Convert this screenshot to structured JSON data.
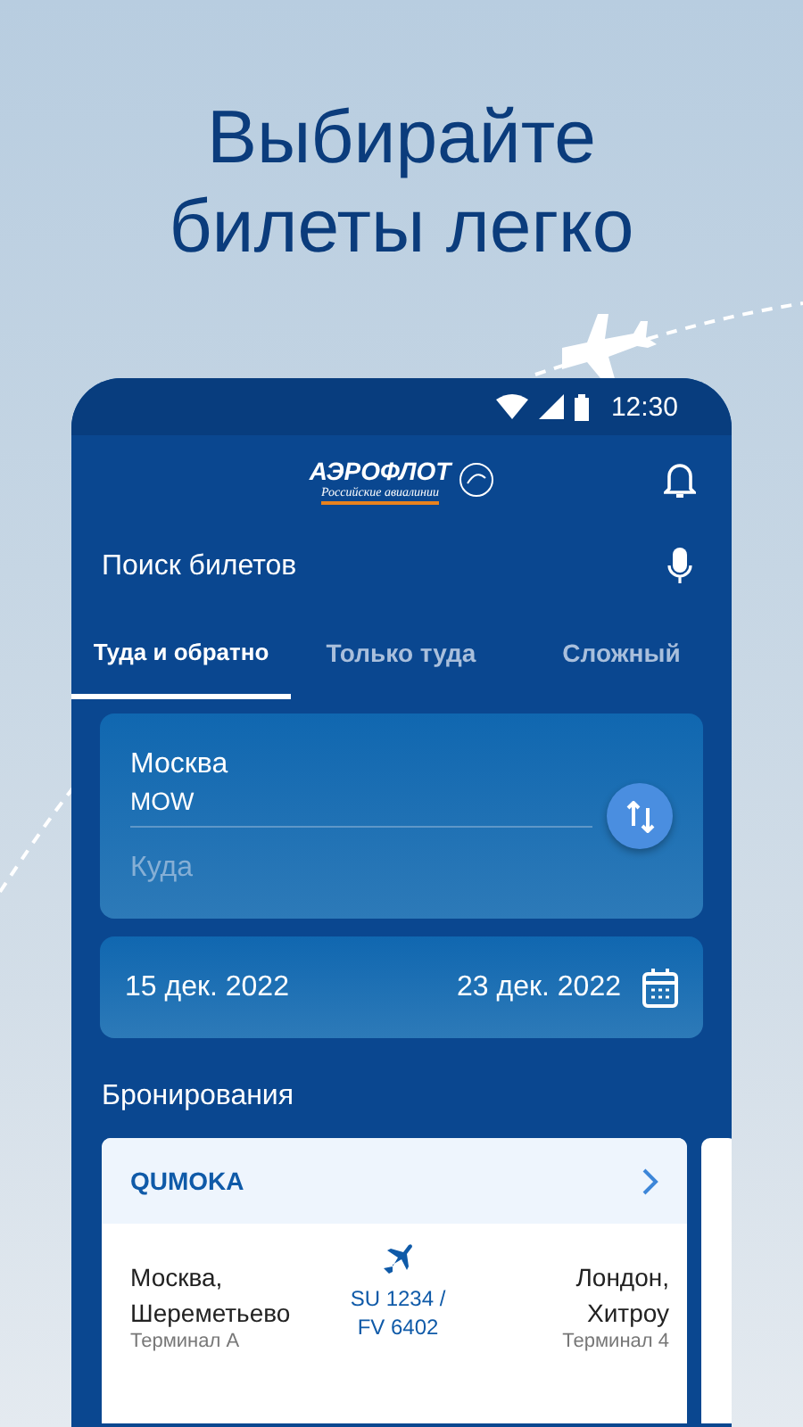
{
  "headline": "Выбирайте билеты легко",
  "status_bar": {
    "time": "12:30"
  },
  "logo": {
    "name": "АЭРОФЛОТ",
    "tagline": "Российские авиалинии"
  },
  "search": {
    "title": "Поиск билетов"
  },
  "tabs": [
    {
      "label": "Туда и обратно",
      "selected": true
    },
    {
      "label": "Только туда",
      "selected": false
    },
    {
      "label": "Сложный",
      "selected": false
    }
  ],
  "route": {
    "from_city": "Москва",
    "from_code": "MOW",
    "to_placeholder": "Куда"
  },
  "dates": {
    "depart": "15 дек. 2022",
    "return": "23 дек. 2022"
  },
  "bookings": {
    "title": "Бронирования",
    "cards": [
      {
        "code": "QUMOKA",
        "from_city": "Москва,",
        "from_airport": "Шереметьево",
        "from_terminal": "Терминал А",
        "flight": "SU 1234 / FV 6402",
        "to_city": "Лондон,",
        "to_airport": "Хитроу",
        "to_terminal": "Терминал 4"
      }
    ]
  }
}
